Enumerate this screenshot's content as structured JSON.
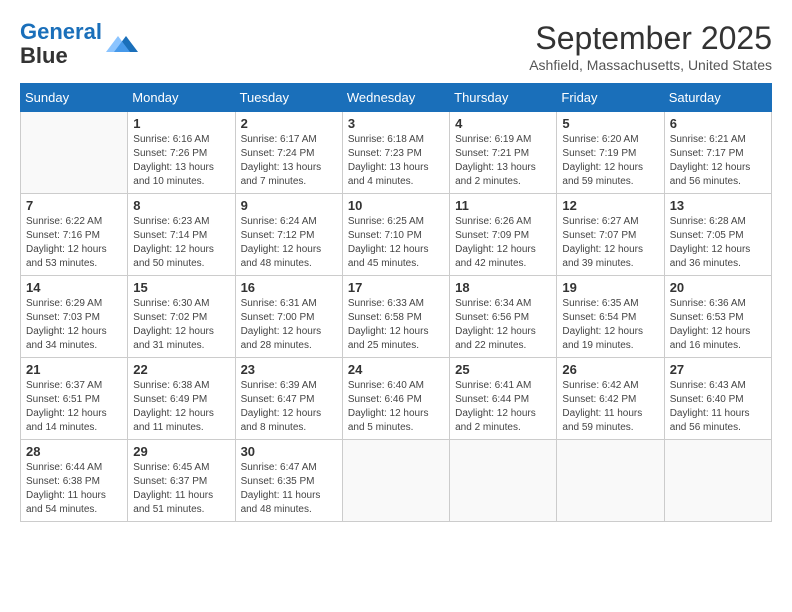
{
  "logo": {
    "line1": "General",
    "line2": "Blue"
  },
  "title": "September 2025",
  "location": "Ashfield, Massachusetts, United States",
  "days_of_week": [
    "Sunday",
    "Monday",
    "Tuesday",
    "Wednesday",
    "Thursday",
    "Friday",
    "Saturday"
  ],
  "weeks": [
    [
      {
        "day": "",
        "info": ""
      },
      {
        "day": "1",
        "info": "Sunrise: 6:16 AM\nSunset: 7:26 PM\nDaylight: 13 hours and 10 minutes."
      },
      {
        "day": "2",
        "info": "Sunrise: 6:17 AM\nSunset: 7:24 PM\nDaylight: 13 hours and 7 minutes."
      },
      {
        "day": "3",
        "info": "Sunrise: 6:18 AM\nSunset: 7:23 PM\nDaylight: 13 hours and 4 minutes."
      },
      {
        "day": "4",
        "info": "Sunrise: 6:19 AM\nSunset: 7:21 PM\nDaylight: 13 hours and 2 minutes."
      },
      {
        "day": "5",
        "info": "Sunrise: 6:20 AM\nSunset: 7:19 PM\nDaylight: 12 hours and 59 minutes."
      },
      {
        "day": "6",
        "info": "Sunrise: 6:21 AM\nSunset: 7:17 PM\nDaylight: 12 hours and 56 minutes."
      }
    ],
    [
      {
        "day": "7",
        "info": "Sunrise: 6:22 AM\nSunset: 7:16 PM\nDaylight: 12 hours and 53 minutes."
      },
      {
        "day": "8",
        "info": "Sunrise: 6:23 AM\nSunset: 7:14 PM\nDaylight: 12 hours and 50 minutes."
      },
      {
        "day": "9",
        "info": "Sunrise: 6:24 AM\nSunset: 7:12 PM\nDaylight: 12 hours and 48 minutes."
      },
      {
        "day": "10",
        "info": "Sunrise: 6:25 AM\nSunset: 7:10 PM\nDaylight: 12 hours and 45 minutes."
      },
      {
        "day": "11",
        "info": "Sunrise: 6:26 AM\nSunset: 7:09 PM\nDaylight: 12 hours and 42 minutes."
      },
      {
        "day": "12",
        "info": "Sunrise: 6:27 AM\nSunset: 7:07 PM\nDaylight: 12 hours and 39 minutes."
      },
      {
        "day": "13",
        "info": "Sunrise: 6:28 AM\nSunset: 7:05 PM\nDaylight: 12 hours and 36 minutes."
      }
    ],
    [
      {
        "day": "14",
        "info": "Sunrise: 6:29 AM\nSunset: 7:03 PM\nDaylight: 12 hours and 34 minutes."
      },
      {
        "day": "15",
        "info": "Sunrise: 6:30 AM\nSunset: 7:02 PM\nDaylight: 12 hours and 31 minutes."
      },
      {
        "day": "16",
        "info": "Sunrise: 6:31 AM\nSunset: 7:00 PM\nDaylight: 12 hours and 28 minutes."
      },
      {
        "day": "17",
        "info": "Sunrise: 6:33 AM\nSunset: 6:58 PM\nDaylight: 12 hours and 25 minutes."
      },
      {
        "day": "18",
        "info": "Sunrise: 6:34 AM\nSunset: 6:56 PM\nDaylight: 12 hours and 22 minutes."
      },
      {
        "day": "19",
        "info": "Sunrise: 6:35 AM\nSunset: 6:54 PM\nDaylight: 12 hours and 19 minutes."
      },
      {
        "day": "20",
        "info": "Sunrise: 6:36 AM\nSunset: 6:53 PM\nDaylight: 12 hours and 16 minutes."
      }
    ],
    [
      {
        "day": "21",
        "info": "Sunrise: 6:37 AM\nSunset: 6:51 PM\nDaylight: 12 hours and 14 minutes."
      },
      {
        "day": "22",
        "info": "Sunrise: 6:38 AM\nSunset: 6:49 PM\nDaylight: 12 hours and 11 minutes."
      },
      {
        "day": "23",
        "info": "Sunrise: 6:39 AM\nSunset: 6:47 PM\nDaylight: 12 hours and 8 minutes."
      },
      {
        "day": "24",
        "info": "Sunrise: 6:40 AM\nSunset: 6:46 PM\nDaylight: 12 hours and 5 minutes."
      },
      {
        "day": "25",
        "info": "Sunrise: 6:41 AM\nSunset: 6:44 PM\nDaylight: 12 hours and 2 minutes."
      },
      {
        "day": "26",
        "info": "Sunrise: 6:42 AM\nSunset: 6:42 PM\nDaylight: 11 hours and 59 minutes."
      },
      {
        "day": "27",
        "info": "Sunrise: 6:43 AM\nSunset: 6:40 PM\nDaylight: 11 hours and 56 minutes."
      }
    ],
    [
      {
        "day": "28",
        "info": "Sunrise: 6:44 AM\nSunset: 6:38 PM\nDaylight: 11 hours and 54 minutes."
      },
      {
        "day": "29",
        "info": "Sunrise: 6:45 AM\nSunset: 6:37 PM\nDaylight: 11 hours and 51 minutes."
      },
      {
        "day": "30",
        "info": "Sunrise: 6:47 AM\nSunset: 6:35 PM\nDaylight: 11 hours and 48 minutes."
      },
      {
        "day": "",
        "info": ""
      },
      {
        "day": "",
        "info": ""
      },
      {
        "day": "",
        "info": ""
      },
      {
        "day": "",
        "info": ""
      }
    ]
  ]
}
